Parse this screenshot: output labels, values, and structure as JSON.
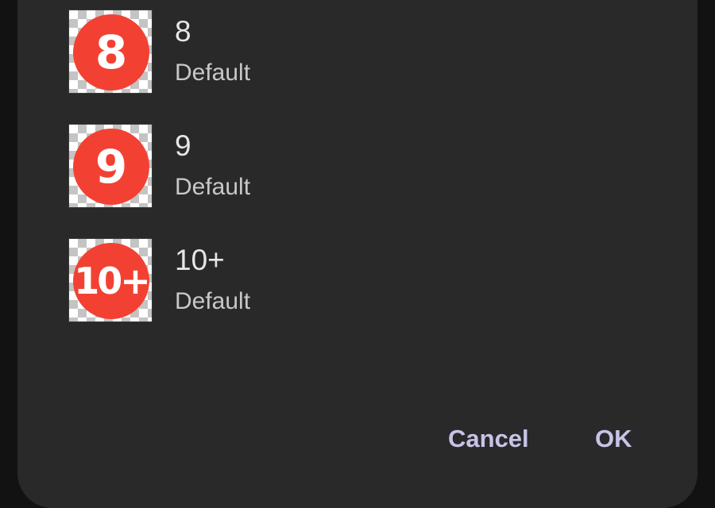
{
  "items": [
    {
      "badge": "8",
      "title": "8",
      "subtitle": "Default"
    },
    {
      "badge": "9",
      "title": "9",
      "subtitle": "Default"
    },
    {
      "badge": "10+",
      "title": "10+",
      "subtitle": "Default"
    }
  ],
  "actions": {
    "cancel_label": "Cancel",
    "ok_label": "OK"
  },
  "colors": {
    "dialog_background": "#292929",
    "badge_red": "#f24133",
    "accent_text": "#c7c3e8"
  },
  "icons": {
    "thumbnail": "transparent-checkerboard-badge-icon"
  }
}
